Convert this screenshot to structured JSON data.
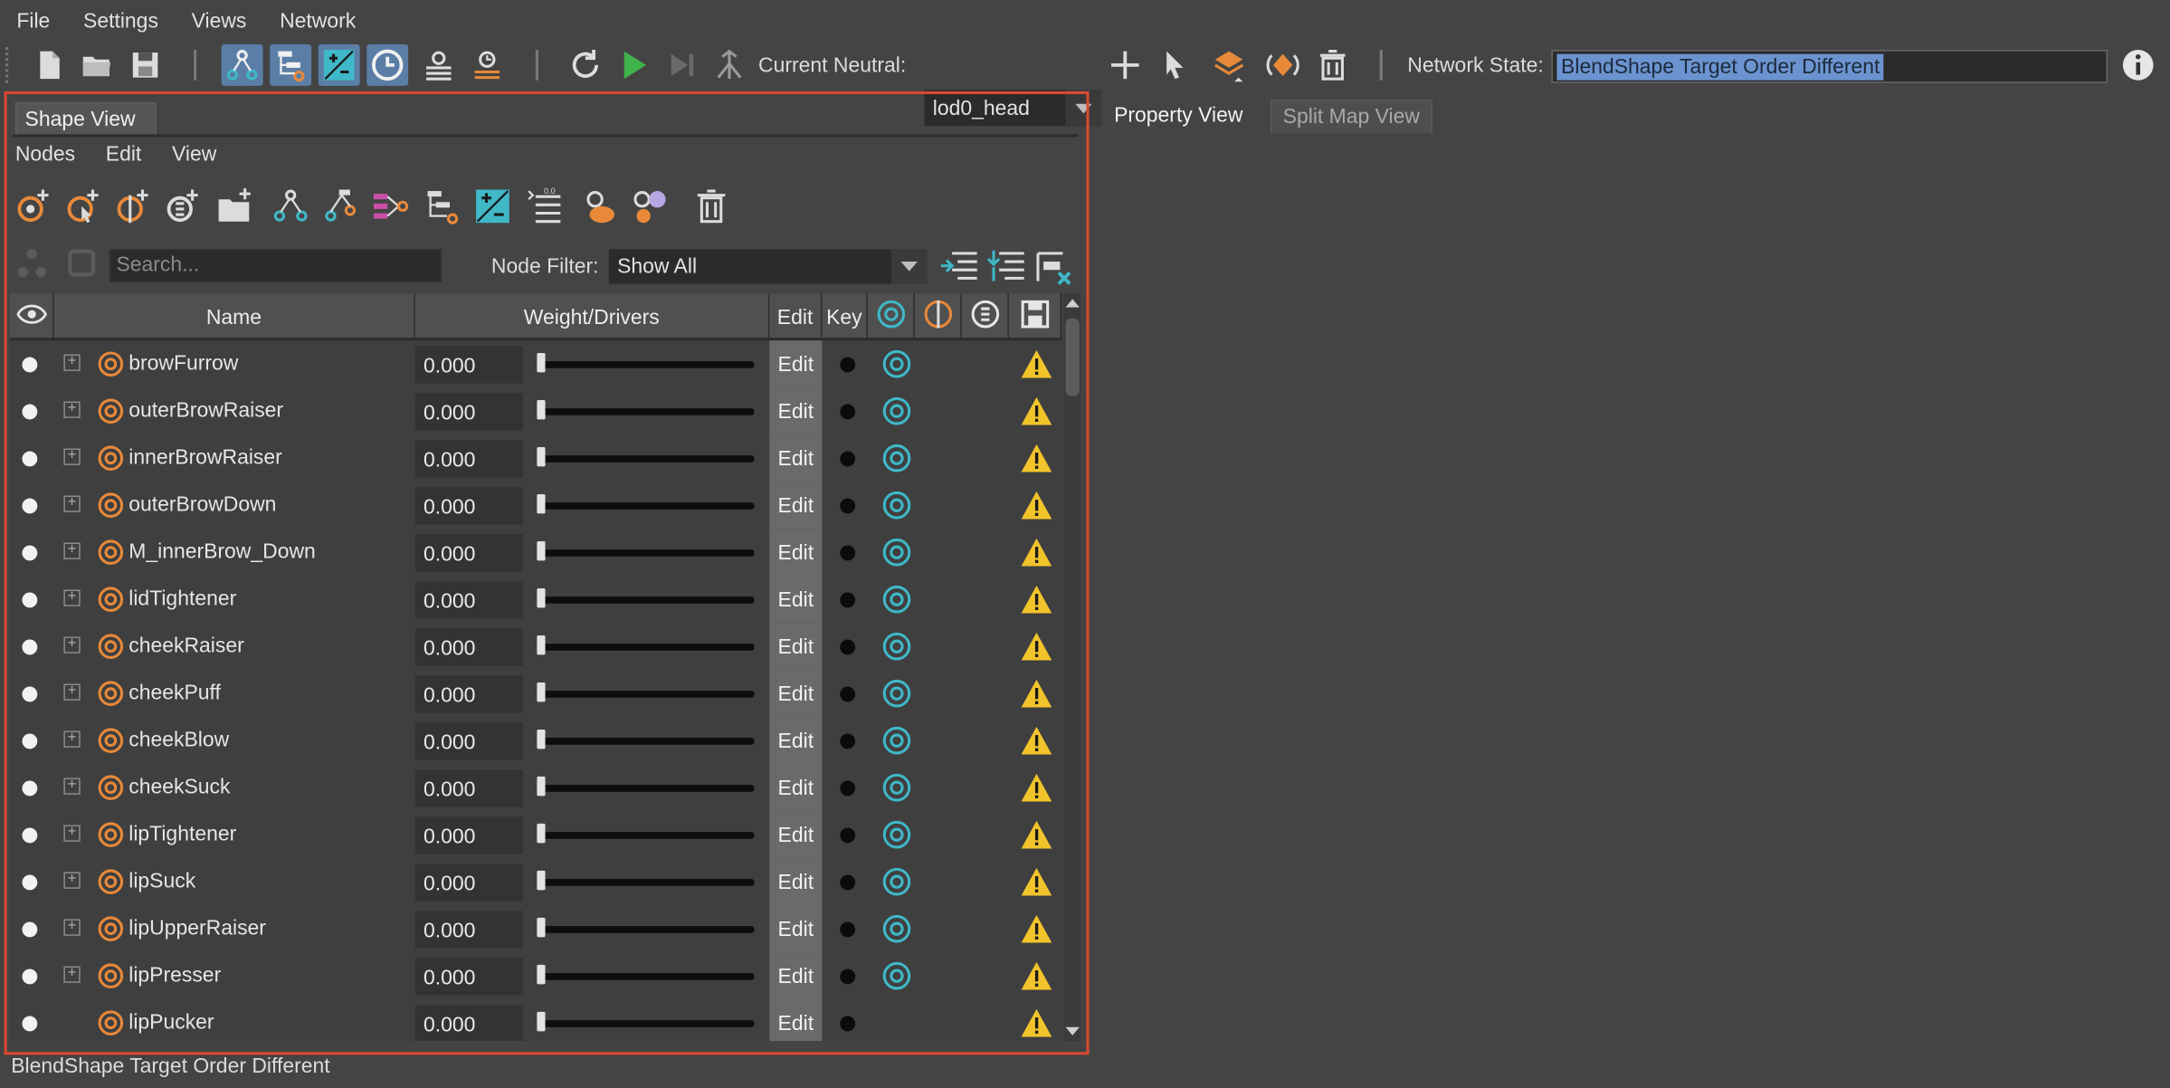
{
  "menubar": {
    "items": [
      "File",
      "Settings",
      "Views",
      "Network"
    ]
  },
  "toolbar": {
    "current_neutral_label": "Current Neutral:",
    "current_neutral_value": "lod0_head",
    "network_state_label": "Network State:",
    "network_state_value": "BlendShape Target Order Different"
  },
  "shape_view": {
    "tab_label": "Shape View",
    "menu": [
      "Nodes",
      "Edit",
      "View"
    ],
    "search_placeholder": "Search...",
    "node_filter_label": "Node Filter:",
    "node_filter_value": "Show All",
    "columns": {
      "name": "Name",
      "weight": "Weight/Drivers",
      "edit": "Edit",
      "key": "Key"
    },
    "rows": [
      {
        "name": "browFurrow",
        "value": "0.000",
        "edit": "Edit",
        "weight": 0,
        "expandable": true,
        "target": true
      },
      {
        "name": "outerBrowRaiser",
        "value": "0.000",
        "edit": "Edit",
        "weight": 0,
        "expandable": true,
        "target": true
      },
      {
        "name": "innerBrowRaiser",
        "value": "0.000",
        "edit": "Edit",
        "weight": 0,
        "expandable": true,
        "target": true
      },
      {
        "name": "outerBrowDown",
        "value": "0.000",
        "edit": "Edit",
        "weight": 0,
        "expandable": true,
        "target": true
      },
      {
        "name": "M_innerBrow_Down",
        "value": "0.000",
        "edit": "Edit",
        "weight": 0,
        "expandable": true,
        "target": true
      },
      {
        "name": "lidTightener",
        "value": "0.000",
        "edit": "Edit",
        "weight": 0,
        "expandable": true,
        "target": true
      },
      {
        "name": "cheekRaiser",
        "value": "0.000",
        "edit": "Edit",
        "weight": 0,
        "expandable": true,
        "target": true
      },
      {
        "name": "cheekPuff",
        "value": "0.000",
        "edit": "Edit",
        "weight": 0,
        "expandable": true,
        "target": true
      },
      {
        "name": "cheekBlow",
        "value": "0.000",
        "edit": "Edit",
        "weight": 0,
        "expandable": true,
        "target": true
      },
      {
        "name": "cheekSuck",
        "value": "0.000",
        "edit": "Edit",
        "weight": 0,
        "expandable": true,
        "target": true
      },
      {
        "name": "lipTightener",
        "value": "0.000",
        "edit": "Edit",
        "weight": 0,
        "expandable": true,
        "target": true
      },
      {
        "name": "lipSuck",
        "value": "0.000",
        "edit": "Edit",
        "weight": 0,
        "expandable": true,
        "target": true
      },
      {
        "name": "lipUpperRaiser",
        "value": "0.000",
        "edit": "Edit",
        "weight": 0,
        "expandable": true,
        "target": true
      },
      {
        "name": "lipPresser",
        "value": "0.000",
        "edit": "Edit",
        "weight": 0,
        "expandable": true,
        "target": true
      },
      {
        "name": "lipPucker",
        "value": "0.000",
        "edit": "Edit",
        "weight": 0,
        "expandable": false,
        "target": false
      }
    ]
  },
  "right_tabs": [
    "Property View",
    "Split Map View"
  ],
  "status_bar": "BlendShape Target Order Different",
  "colors": {
    "accent": "#6b93cf",
    "node_orange": "#e8893a",
    "target_teal": "#3fb8c8",
    "warning": "#f2c42b",
    "highlight_border": "#d94a32"
  }
}
